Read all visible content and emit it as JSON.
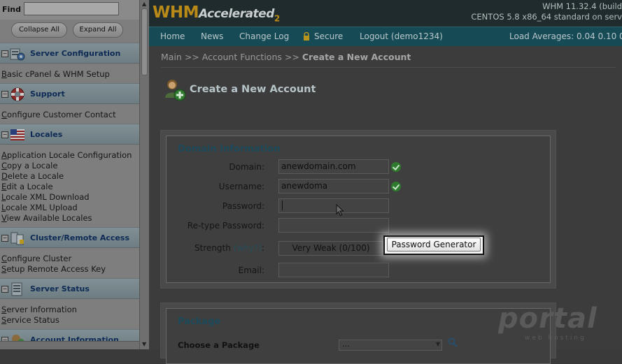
{
  "sidebar": {
    "find_label": "Find",
    "collapse_label": "Collapse All",
    "expand_label": "Expand All",
    "sections": [
      {
        "title": "Server Configuration",
        "icon": "server-config-icon",
        "links": [
          "Basic cPanel & WHM Setup"
        ]
      },
      {
        "title": "Support",
        "icon": "lifebuoy-icon",
        "links": [
          "Configure Customer Contact"
        ]
      },
      {
        "title": "Locales",
        "icon": "flag-icon",
        "links": [
          "Application Locale Configuration",
          "Copy a Locale",
          "Delete a Locale",
          "Edit a Locale",
          "Locale XML Download",
          "Locale XML Upload",
          "View Available Locales"
        ]
      },
      {
        "title": "Cluster/Remote Access",
        "icon": "cluster-icon",
        "links": [
          "Configure Cluster",
          "Setup Remote Access Key"
        ]
      },
      {
        "title": "Server Status",
        "icon": "server-status-icon",
        "links": [
          "Server Information",
          "Service Status"
        ]
      },
      {
        "title": "Account Information",
        "icon": "account-info-icon",
        "links": []
      }
    ]
  },
  "header": {
    "logo_main": "WHM",
    "logo_sub": "Accelerated",
    "logo_num": "2",
    "version": "WHM 11.32.4 (build",
    "os": "CENTOS 5.8 x86_64 standard on serv"
  },
  "nav": {
    "items": [
      "Home",
      "News",
      "Change Log",
      "Secure",
      "Logout (demo1234)"
    ],
    "load_averages": "Load Averages: 0.04 0.10 0"
  },
  "breadcrumb": {
    "main": "Main",
    "sep": ">>",
    "account_functions": "Account Functions",
    "current": "Create a New Account"
  },
  "page": {
    "title": "Create a New Account"
  },
  "domain_info": {
    "heading": "Domain Information",
    "domain_label": "Domain:",
    "domain_value": "anewdomain.com",
    "username_label": "Username:",
    "username_value": "anewdoma",
    "password_label": "Password:",
    "retype_label": "Re-type Password:",
    "strength_label": "Strength",
    "strength_why": "(why?)",
    "strength_colon": ":",
    "strength_value": "Very Weak (0/100)",
    "pw_generator_label": "Password Generator",
    "email_label": "Email:"
  },
  "package": {
    "heading": "Package",
    "choose_label": "Choose a Package",
    "select_value": "..."
  },
  "watermark": {
    "main": "portal",
    "sub": "web hosting"
  },
  "colors": {
    "nav_bg": "#164a55",
    "topbar_bg": "#1f2b2d",
    "logo": "#b98a18",
    "check": "#2f7a2f"
  }
}
